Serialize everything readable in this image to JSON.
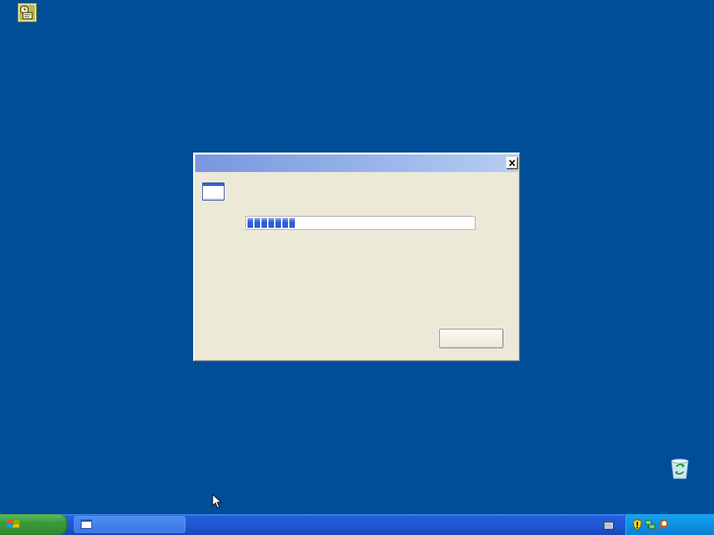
{
  "desktop": {
    "background_color": "#004e98",
    "icons": [
      {
        "icon": "scheduled-task-icon"
      },
      {
        "icon": "recycle-bin-icon"
      }
    ]
  },
  "dialog": {
    "title": "",
    "close_icon": "close-icon",
    "window_icon": "window-icon",
    "progress": {
      "fraction": 0.21,
      "color": "#2b5fd9"
    },
    "cancel_label": ""
  },
  "taskbar": {
    "start_label": "",
    "task_button_label": "",
    "tray_icons": [
      "keyboard-icon",
      "security-shield-icon",
      "network-icon",
      "search-icon"
    ],
    "clock": ""
  }
}
